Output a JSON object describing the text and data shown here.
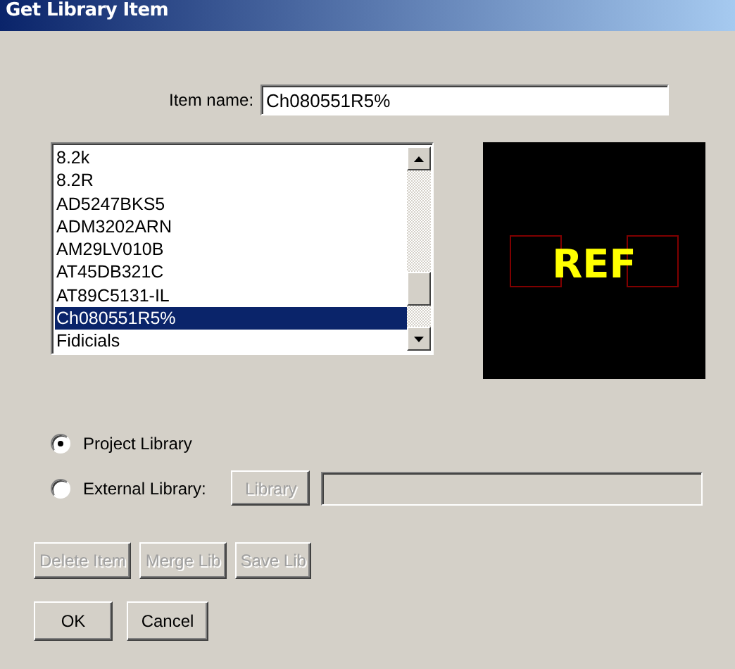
{
  "window": {
    "title": "Get Library Item"
  },
  "item_name": {
    "label": "Item name:",
    "value": "Ch080551R5%"
  },
  "list": {
    "items": [
      {
        "label": "8.2k",
        "selected": false
      },
      {
        "label": "8.2R",
        "selected": false
      },
      {
        "label": "AD5247BKS5",
        "selected": false
      },
      {
        "label": "ADM3202ARN",
        "selected": false
      },
      {
        "label": "AM29LV010B",
        "selected": false
      },
      {
        "label": "AT45DB321C",
        "selected": false
      },
      {
        "label": "AT89C5131-IL",
        "selected": false
      },
      {
        "label": "Ch080551R5%",
        "selected": true
      },
      {
        "label": "Fidicials",
        "selected": false
      }
    ]
  },
  "preview": {
    "label": "REF"
  },
  "source": [
    {
      "label": "Project Library",
      "selected": true
    },
    {
      "label": "External Library:",
      "selected": false
    }
  ],
  "library_button": {
    "label": "Library",
    "disabled": true
  },
  "library_field": {
    "disabled": true
  },
  "actions": [
    {
      "label": "Delete Item",
      "disabled": true
    },
    {
      "label": "Merge Lib",
      "disabled": true
    },
    {
      "label": "Save Lib",
      "disabled": true
    }
  ],
  "buttons": [
    {
      "label": "OK",
      "disabled": false
    },
    {
      "label": "Cancel",
      "disabled": false
    }
  ]
}
